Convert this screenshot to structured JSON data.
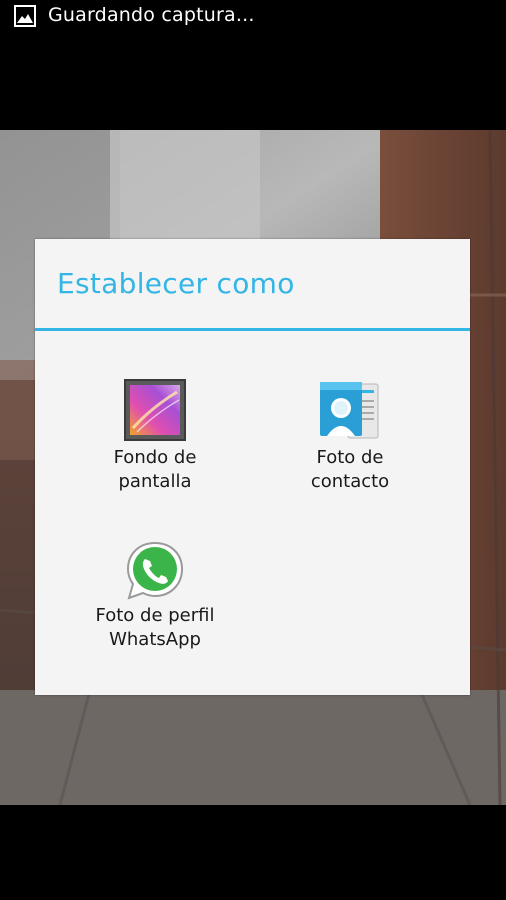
{
  "status_bar": {
    "notification_icon": "image-icon",
    "text": "Guardando captura..."
  },
  "dialog": {
    "title": "Establecer como",
    "accent_color": "#33b5e5",
    "options": [
      {
        "label": "Fondo de\npantalla",
        "icon": "wallpaper-icon"
      },
      {
        "label": "Foto de\ncontacto",
        "icon": "contact-icon"
      },
      {
        "label": "Foto de perfil\nWhatsApp",
        "icon": "whatsapp-icon"
      }
    ]
  }
}
